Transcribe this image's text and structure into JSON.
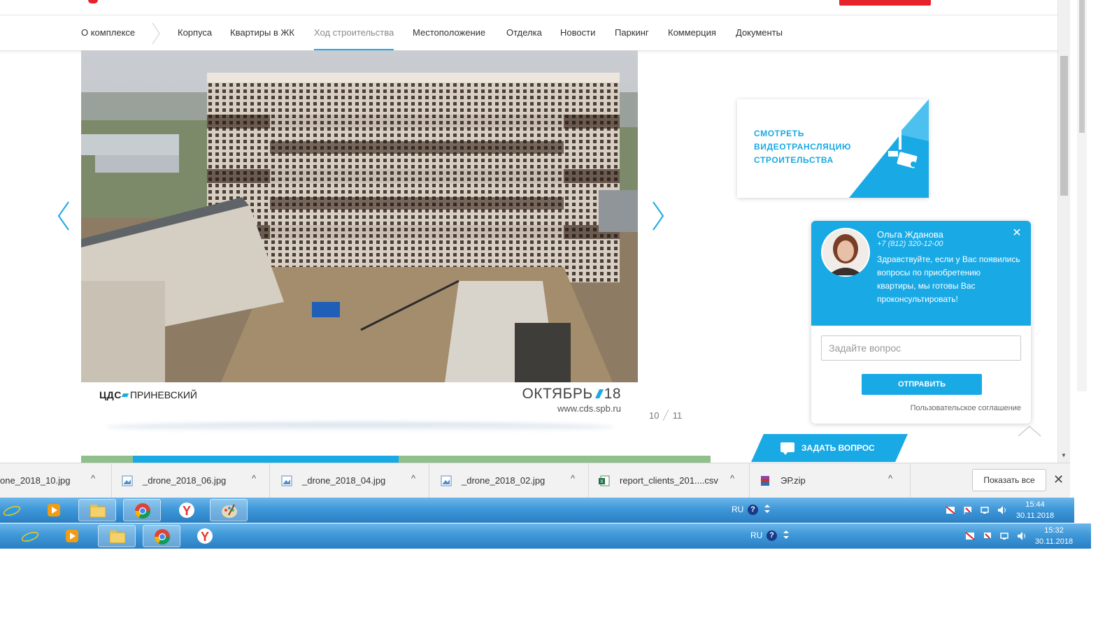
{
  "nav": {
    "items": [
      {
        "label": "О комплексе",
        "active": false
      },
      {
        "label": "Корпуса",
        "active": false
      },
      {
        "label": "Квартиры в ЖК",
        "active": false
      },
      {
        "label": "Ход строительства",
        "active": true
      },
      {
        "label": "Местоположение",
        "active": false
      },
      {
        "label": "Отделка",
        "active": false
      },
      {
        "label": "Новости",
        "active": false
      },
      {
        "label": "Паркинг",
        "active": false
      },
      {
        "label": "Коммерция",
        "active": false
      },
      {
        "label": "Документы",
        "active": false
      }
    ]
  },
  "gallery": {
    "brand_prefix": "ЦДС",
    "brand_name": "ПРИНЕВСКИЙ",
    "month": "ОКТЯБРЬ",
    "year": "18",
    "site": "www.cds.spb.ru",
    "current": "10",
    "total": "11"
  },
  "video_card": {
    "label": "СМОТРЕТЬ ВИДЕОТРАНСЛЯЦИЮ СТРОИТЕЛЬСТВА"
  },
  "chat": {
    "agent_name": "Ольга Жданова",
    "agent_phone": "+7 (812) 320-12-00",
    "message": "Здравствуйте, если у Вас появились вопросы по приобретению квартиры, мы готовы Вас проконсультировать!",
    "close_glyph": "✕",
    "input_placeholder": "Задайте вопрос",
    "send_label": "ОТПРАВИТЬ",
    "terms": "Пользовательское соглашение"
  },
  "ask_tab": {
    "label": "ЗАДАТЬ ВОПРОС"
  },
  "downloads": {
    "items": [
      {
        "name": "one_2018_10.jpg",
        "icon": "image-file-icon"
      },
      {
        "name": "_drone_2018_06.jpg",
        "icon": "image-file-icon"
      },
      {
        "name": "_drone_2018_04.jpg",
        "icon": "image-file-icon"
      },
      {
        "name": "_drone_2018_02.jpg",
        "icon": "image-file-icon"
      },
      {
        "name": "report_clients_201....csv",
        "icon": "excel-file-icon"
      },
      {
        "name": "ЭР.zip",
        "icon": "archive-file-icon"
      }
    ],
    "caret": "^",
    "show_all": "Показать все",
    "close_glyph": "✕"
  },
  "taskbar_top": {
    "lang": "RU",
    "time": "15:44",
    "date": "30.11.2018"
  },
  "taskbar_bottom": {
    "lang": "RU",
    "time": "15:32",
    "date": "30.11.2018"
  },
  "colors": {
    "accent": "#19a9e5",
    "brand_red": "#e4232b"
  }
}
